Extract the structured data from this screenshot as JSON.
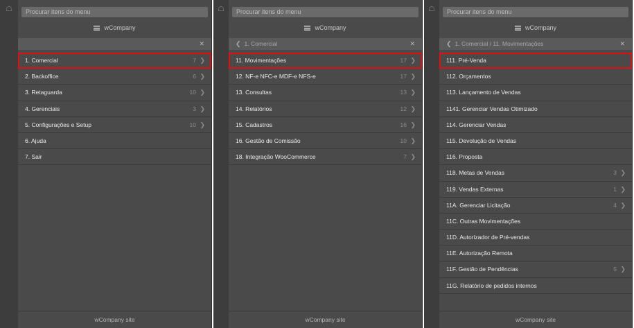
{
  "panels": [
    {
      "search_placeholder": "Procurar itens do menu",
      "brand": "wCompany",
      "breadcrumb": "",
      "footer": "wCompany site",
      "items": [
        {
          "label": "1. Comercial",
          "count": "7",
          "highlight": true
        },
        {
          "label": "2. Backoffice",
          "count": "6"
        },
        {
          "label": "3. Retaguarda",
          "count": "10"
        },
        {
          "label": "4. Gerenciais",
          "count": "3"
        },
        {
          "label": "5. Configurações e Setup",
          "count": "10"
        },
        {
          "label": "6. Ajuda"
        },
        {
          "label": "7. Sair"
        }
      ]
    },
    {
      "search_placeholder": "Procurar itens do menu",
      "brand": "wCompany",
      "breadcrumb": "1. Comercial",
      "footer": "wCompany site",
      "items": [
        {
          "label": "11. Movimentações",
          "count": "17",
          "highlight": true
        },
        {
          "label": "12. NF-e NFC-e MDF-e NFS-e",
          "count": "17"
        },
        {
          "label": "13. Consultas",
          "count": "13"
        },
        {
          "label": "14. Relatórios",
          "count": "12"
        },
        {
          "label": "15. Cadastros",
          "count": "16"
        },
        {
          "label": "16. Gestão de Comissão",
          "count": "10"
        },
        {
          "label": "18. Integração WooCommerce",
          "count": "7"
        }
      ]
    },
    {
      "search_placeholder": "Procurar itens do menu",
      "brand": "wCompany",
      "breadcrumb": "1. Comercial / 11. Movimentações",
      "footer": "wCompany site",
      "items": [
        {
          "label": "111. Pré-Venda",
          "highlight": true
        },
        {
          "label": "112. Orçamentos"
        },
        {
          "label": "113. Lançamento de Vendas"
        },
        {
          "label": "1141. Gerenciar Vendas Otimizado"
        },
        {
          "label": "114. Gerenciar Vendas"
        },
        {
          "label": "115. Devolução de Vendas"
        },
        {
          "label": "116. Proposta"
        },
        {
          "label": "118. Metas de Vendas",
          "count": "3"
        },
        {
          "label": "119. Vendas Externas",
          "count": "1"
        },
        {
          "label": "11A. Gerenciar Licitação",
          "count": "4"
        },
        {
          "label": "11C. Outras Movimentações"
        },
        {
          "label": "11D. Autorizador de Pré-vendas"
        },
        {
          "label": "11E. Autorização Remota"
        },
        {
          "label": "11F. Gestão de Pendências",
          "count": "5"
        },
        {
          "label": "11G. Relatório de pedidos internos"
        }
      ]
    }
  ],
  "icons": {
    "home": "home-icon",
    "menu": "hamburger-icon",
    "back": "chevron-left-icon",
    "close": "close-icon",
    "submenu": "chevron-right-icon"
  },
  "colors": {
    "panel_bg": "#4a4a4a",
    "strip_bg": "#3d3d3d",
    "highlight_border": "#e01010"
  }
}
